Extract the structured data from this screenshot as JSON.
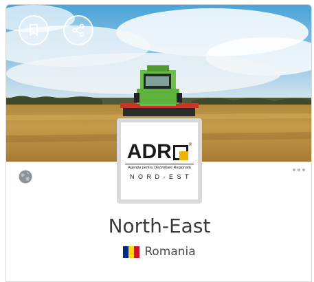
{
  "card": {
    "cover": {
      "bookmark_button": {
        "icon": "bookmark-icon"
      },
      "share_button": {
        "icon": "share-icon"
      }
    },
    "logo": {
      "text": "ADR",
      "registered_mark": "®",
      "subtitle": "Agenția pentru Dezvoltare Regională",
      "region": "NORD-EST",
      "accent_color": "#f0b400"
    },
    "globe_icon": "globe-icon",
    "more_icon": "more-dots-icon",
    "title": "North-East",
    "country": {
      "name": "Romania",
      "flag_icon": "romania-flag-icon",
      "flag_colors": [
        "#002b7f",
        "#fcd116",
        "#ce1126"
      ]
    }
  }
}
